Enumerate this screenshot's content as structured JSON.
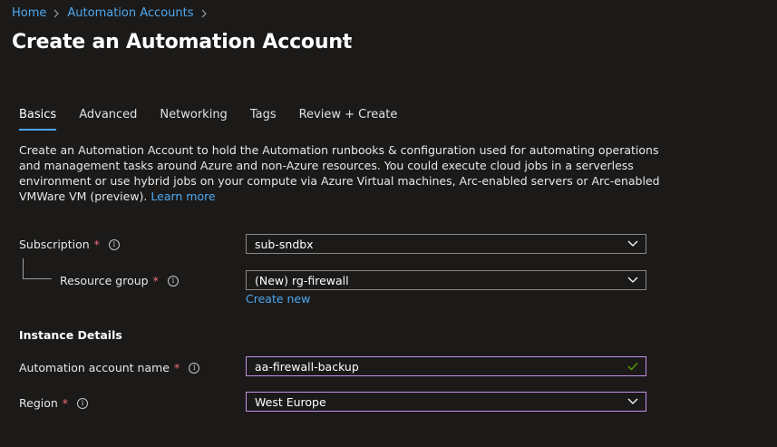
{
  "breadcrumb": [
    {
      "label": "Home"
    },
    {
      "label": "Automation Accounts"
    }
  ],
  "page": {
    "title": "Create an Automation Account",
    "more_label": "···"
  },
  "tabs": [
    {
      "label": "Basics"
    },
    {
      "label": "Advanced"
    },
    {
      "label": "Networking"
    },
    {
      "label": "Tags"
    },
    {
      "label": "Review + Create"
    }
  ],
  "description": {
    "text": "Create an Automation Account to hold the Automation runbooks & configuration used for automating operations and management tasks around Azure and non-Azure resources. You could execute cloud jobs in a serverless environment or use hybrid jobs on your compute via Azure Virtual machines, Arc-enabled servers or Arc-enabled VMWare VM (preview).",
    "learn_more": "Learn more"
  },
  "form": {
    "subscription": {
      "label": "Subscription",
      "required": "*",
      "value": "sub-sndbx"
    },
    "resource_group": {
      "label": "Resource group",
      "required": "*",
      "value": "(New) rg-firewall",
      "create_new": "Create new"
    },
    "instance_details": "Instance Details",
    "account_name": {
      "label": "Automation account name",
      "required": "*",
      "value": "aa-firewall-backup"
    },
    "region": {
      "label": "Region",
      "required": "*",
      "value": "West Europe"
    },
    "info_glyph": "i"
  },
  "icons": {
    "chevron_right": "chevron-right-icon",
    "chevron_down": "chevron-down-icon",
    "check": "check-icon",
    "info": "info-icon"
  },
  "colors": {
    "background": "#1b1a19",
    "link": "#4ea8f0",
    "required": "#f1707b",
    "focus_border": "#c48fe8",
    "field_border": "#8a8886"
  }
}
